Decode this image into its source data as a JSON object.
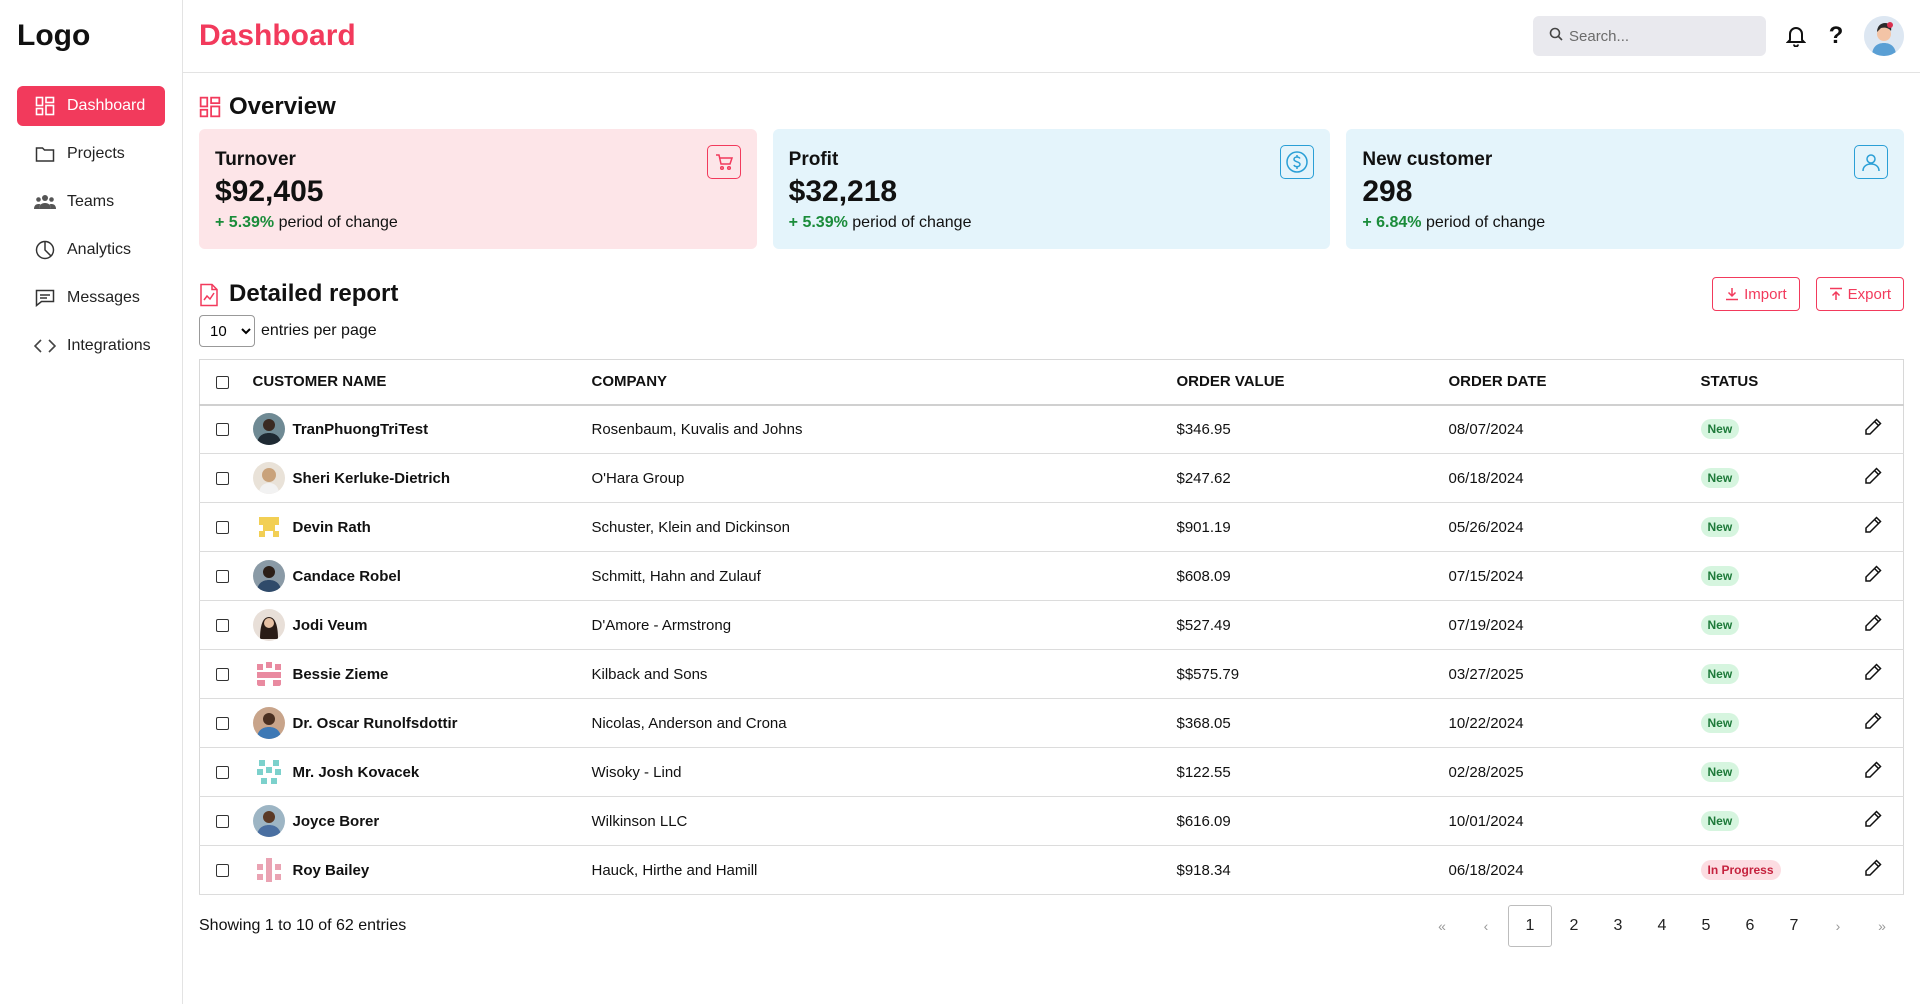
{
  "sidebar": {
    "logo": "Logo",
    "items": [
      {
        "label": "Dashboard",
        "icon": "dashboard-grid-icon",
        "active": true
      },
      {
        "label": "Projects",
        "icon": "folder-icon"
      },
      {
        "label": "Teams",
        "icon": "teams-icon"
      },
      {
        "label": "Analytics",
        "icon": "pie-chart-icon"
      },
      {
        "label": "Messages",
        "icon": "message-icon"
      },
      {
        "label": "Integrations",
        "icon": "code-icon"
      }
    ]
  },
  "header": {
    "title": "Dashboard",
    "search_placeholder": "Search...",
    "help_glyph": "?"
  },
  "overview": {
    "title": "Overview",
    "cards": [
      {
        "label": "Turnover",
        "value": "$92,405",
        "pct": "+ 5.39%",
        "suffix": " period of change",
        "icon": "cart-icon"
      },
      {
        "label": "Profit",
        "value": "$32,218",
        "pct": "+ 5.39%",
        "suffix": " period of change",
        "icon": "dollar-icon"
      },
      {
        "label": "New customer",
        "value": "298",
        "pct": "+ 6.84%",
        "suffix": " period of change",
        "icon": "user-icon"
      }
    ]
  },
  "report": {
    "title": "Detailed report",
    "import_label": "Import",
    "export_label": "Export",
    "entries_value": "10",
    "entries_label": "entries per page",
    "columns": [
      "CUSTOMER NAME",
      "COMPANY",
      "ORDER VALUE",
      "ORDER DATE",
      "STATUS"
    ],
    "rows": [
      {
        "name": "TranPhuongTriTest",
        "company": "Rosenbaum, Kuvalis and Johns",
        "value": "$346.95",
        "date": "08/07/2024",
        "status": "New"
      },
      {
        "name": "Sheri Kerluke-Dietrich",
        "company": "O'Hara Group",
        "value": "$247.62",
        "date": "06/18/2024",
        "status": "New"
      },
      {
        "name": "Devin Rath",
        "company": "Schuster, Klein and Dickinson",
        "value": "$901.19",
        "date": "05/26/2024",
        "status": "New"
      },
      {
        "name": "Candace Robel",
        "company": "Schmitt, Hahn and Zulauf",
        "value": "$608.09",
        "date": "07/15/2024",
        "status": "New"
      },
      {
        "name": "Jodi Veum",
        "company": "D'Amore - Armstrong",
        "value": "$527.49",
        "date": "07/19/2024",
        "status": "New"
      },
      {
        "name": "Bessie Zieme",
        "company": "Kilback and Sons",
        "value": "$$575.79",
        "date": "03/27/2025",
        "status": "New"
      },
      {
        "name": "Dr. Oscar Runolfsdottir",
        "company": "Nicolas, Anderson and Crona",
        "value": "$368.05",
        "date": "10/22/2024",
        "status": "New"
      },
      {
        "name": "Mr. Josh Kovacek",
        "company": "Wisoky - Lind",
        "value": "$122.55",
        "date": "02/28/2025",
        "status": "New"
      },
      {
        "name": "Joyce Borer",
        "company": "Wilkinson LLC",
        "value": "$616.09",
        "date": "10/01/2024",
        "status": "New"
      },
      {
        "name": "Roy Bailey",
        "company": "Hauck, Hirthe and Hamill",
        "value": "$918.34",
        "date": "06/18/2024",
        "status": "In Progress"
      }
    ],
    "showing": "Showing 1 to 10 of 62 entries",
    "pagination": [
      "«",
      "‹",
      "1",
      "2",
      "3",
      "4",
      "5",
      "6",
      "7",
      "›",
      "»"
    ],
    "current_page": "1"
  },
  "colors": {
    "accent": "#f23a5c",
    "card_pink": "#fde5e8",
    "card_blue": "#e4f4fb",
    "positive": "#1a8c3a"
  }
}
